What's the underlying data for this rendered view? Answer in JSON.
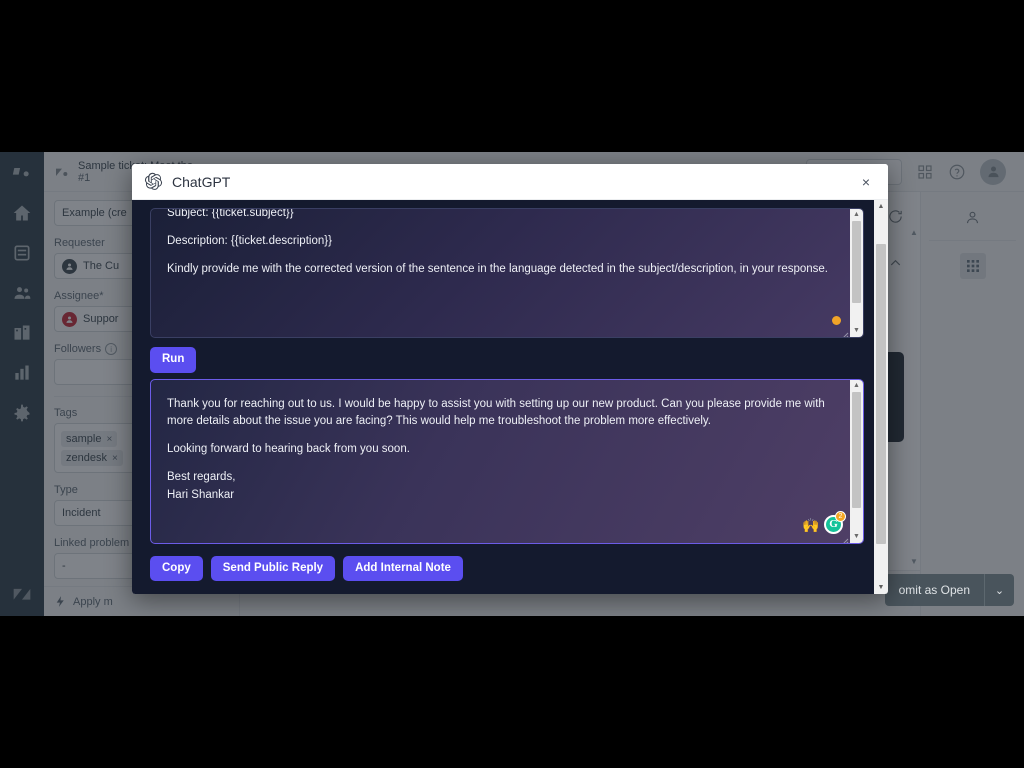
{
  "background_app": {
    "name": "Zendesk Support",
    "rail_icons": [
      {
        "name": "zendesk-products-icon"
      },
      {
        "name": "home-icon"
      },
      {
        "name": "views-icon"
      },
      {
        "name": "customers-icon"
      },
      {
        "name": "organizations-icon"
      },
      {
        "name": "reporting-icon"
      },
      {
        "name": "admin-gear-icon"
      }
    ],
    "brand_icon": "zendesk-logo-icon",
    "tab": {
      "title": "Sample ticket: Meet the",
      "number": "#1",
      "icon": "ticket-icon"
    },
    "subject_field": {
      "value": "Example (cre"
    },
    "header_icons": [
      {
        "name": "search-icon"
      },
      {
        "name": "apps-grid-icon"
      },
      {
        "name": "help-icon"
      },
      {
        "name": "user-avatar-icon"
      }
    ],
    "fields": [
      {
        "label": "Requester",
        "value": "The Cu",
        "avatar": "requester-avatar"
      },
      {
        "label": "Assignee*",
        "value": "Suppor",
        "avatar": "assignee-avatar"
      },
      {
        "label": "Followers",
        "value": "",
        "info": "i"
      }
    ],
    "tags": {
      "label": "Tags",
      "items": [
        "sample",
        "zendesk"
      ],
      "remove_glyph": "×"
    },
    "type": {
      "label": "Type",
      "value": "Incident"
    },
    "linked_problem": {
      "label": "Linked problem",
      "value": "-"
    },
    "macro_bar": {
      "label": "Apply m",
      "icon": "macro-bolt-icon"
    },
    "center_tools": [
      {
        "name": "refresh-icon"
      },
      {
        "name": "chevron-up-icon"
      }
    ],
    "right_panel": [
      {
        "name": "user-profile-icon"
      },
      {
        "name": "apps-tile-icon"
      }
    ],
    "submit": {
      "label": "omit as Open",
      "caret": "⌄"
    },
    "scrollbar": {
      "up": "▲",
      "down": "▼"
    }
  },
  "modal": {
    "title": "ChatGPT",
    "logo_icon": "openai-logo-icon",
    "close_label": "×",
    "prompt": {
      "lines": [
        "Subject: {{ticket.subject}}",
        "Description: {{ticket.description}}",
        "Kindly provide me with the corrected version of the sentence in the language detected in the subject/description, in your response."
      ],
      "status_dot_color": "#f0a428",
      "scrollbar": {
        "up": "▲",
        "down": "▼"
      }
    },
    "run_button": "Run",
    "answer": {
      "lines": [
        "Thank you for reaching out to us. I would be happy to assist you with setting up our new product. Can you please provide me with more details about the issue you are facing? This would help me troubleshoot the problem more effectively.",
        "Looking forward to hearing back from you soon.",
        "Best regards,",
        "Hari Shankar"
      ],
      "extensions": [
        {
          "name": "hands-emoji-icon",
          "label": "🙌"
        },
        {
          "name": "grammarly-icon",
          "letter": "G",
          "badge": "2"
        }
      ],
      "scrollbar": {
        "up": "▲",
        "down": "▼"
      }
    },
    "actions": [
      {
        "label": "Copy",
        "name": "copy-button"
      },
      {
        "label": "Send Public Reply",
        "name": "send-public-reply-button"
      },
      {
        "label": "Add Internal Note",
        "name": "add-internal-note-button"
      }
    ],
    "scrollbar": {
      "up": "▲",
      "down": "▼"
    },
    "accent_color": "#5b4ef0",
    "body_color": "#141a2e"
  }
}
